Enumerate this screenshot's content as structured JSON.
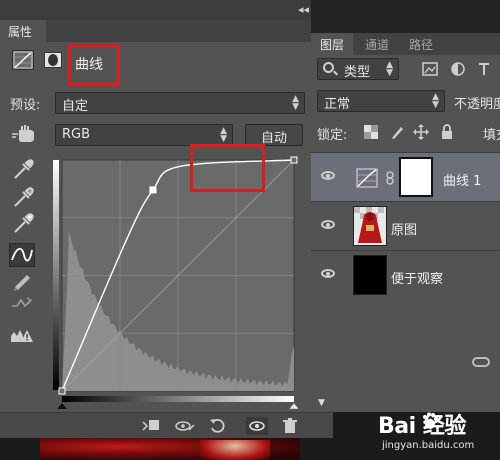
{
  "properties_panel": {
    "tab_label": "属性",
    "collapse_glyph": "◂◂",
    "close_glyph": "✕",
    "adjustment_label": "曲线",
    "preset_label": "预设:",
    "preset_value": "自定",
    "channel_value": "RGB",
    "auto_button": "自动"
  },
  "layers_panel": {
    "tabs": [
      {
        "label": "图层",
        "active": true
      },
      {
        "label": "通道",
        "active": false
      },
      {
        "label": "路径",
        "active": false
      }
    ],
    "kind_filter": "类型",
    "blend_mode": "正常",
    "opacity_label": "不透明度",
    "lock_label": "锁定:",
    "fill_label": "填充",
    "layers": [
      {
        "name": "曲线 1",
        "selected": true,
        "type": "adjustment"
      },
      {
        "name": "原图",
        "selected": false,
        "type": "image"
      },
      {
        "name": "便于观察",
        "selected": false,
        "type": "solid-black"
      }
    ]
  },
  "curve": {
    "points": [
      [
        0,
        0
      ],
      [
        70,
        165
      ],
      [
        100,
        222
      ],
      [
        130,
        248
      ],
      [
        255,
        255
      ]
    ],
    "handle_in": [
      0,
      0
    ],
    "handle_out": [
      255,
      255
    ]
  },
  "watermark": {
    "main": "Bai  经验",
    "sub": "jingyan.baidu.com"
  },
  "colors": {
    "annotation_red": "#e11b1b",
    "panel_bg": "#535353",
    "selected_row": "#6b6f7a"
  }
}
